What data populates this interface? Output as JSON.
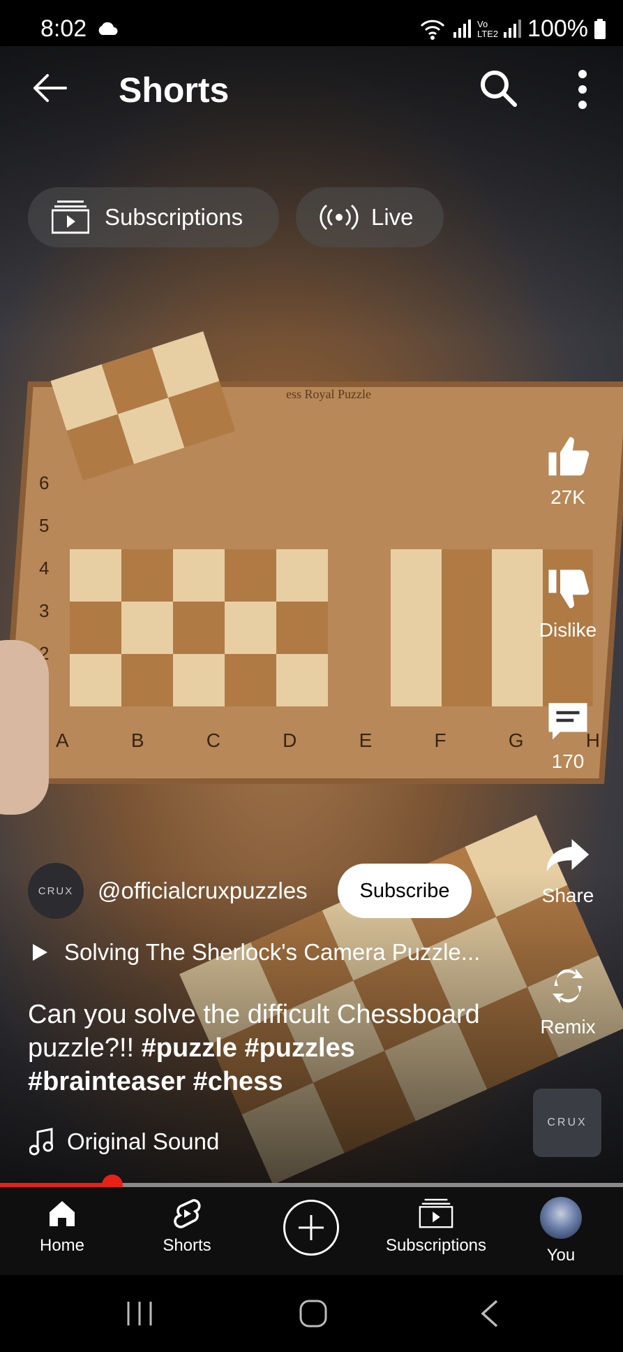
{
  "status_bar": {
    "time": "8:02",
    "battery": "100%",
    "network_label": "Vo LTE2"
  },
  "header": {
    "title": "Shorts"
  },
  "chips": [
    {
      "label": "Subscriptions",
      "icon": "subscriptions-icon"
    },
    {
      "label": "Live",
      "icon": "live-icon"
    }
  ],
  "rail": {
    "like_count": "27K",
    "dislike_label": "Dislike",
    "comment_count": "170",
    "share_label": "Share",
    "remix_label": "Remix"
  },
  "channel": {
    "avatar_text": "CRUX",
    "handle": "@officialcruxpuzzles",
    "subscribe_label": "Subscribe"
  },
  "related_video": "Solving The Sherlock's Camera Puzzle...",
  "caption": {
    "text": "Can you solve the difficult Chessboard puzzle?!! ",
    "tags": "#puzzle #puzzles #brainteaser #chess"
  },
  "sound": {
    "label": "Original Sound",
    "thumb_text": "CRUX"
  },
  "progress": {
    "fraction": 0.18
  },
  "board_text": {
    "files": [
      "A",
      "B",
      "C",
      "D",
      "E",
      "F",
      "G",
      "H"
    ],
    "ranks": [
      "6",
      "5",
      "4",
      "3",
      "2"
    ],
    "engraving": "ess Royal Puzzle"
  },
  "bottom_nav": [
    {
      "label": "Home",
      "icon": "home-icon"
    },
    {
      "label": "Shorts",
      "icon": "shorts-icon"
    },
    {
      "label": "",
      "icon": "create-icon"
    },
    {
      "label": "Subscriptions",
      "icon": "subscriptions-icon"
    },
    {
      "label": "You",
      "icon": "avatar"
    }
  ],
  "colors": {
    "accent": "#e62117",
    "nav_bg": "#0f0f0f"
  }
}
